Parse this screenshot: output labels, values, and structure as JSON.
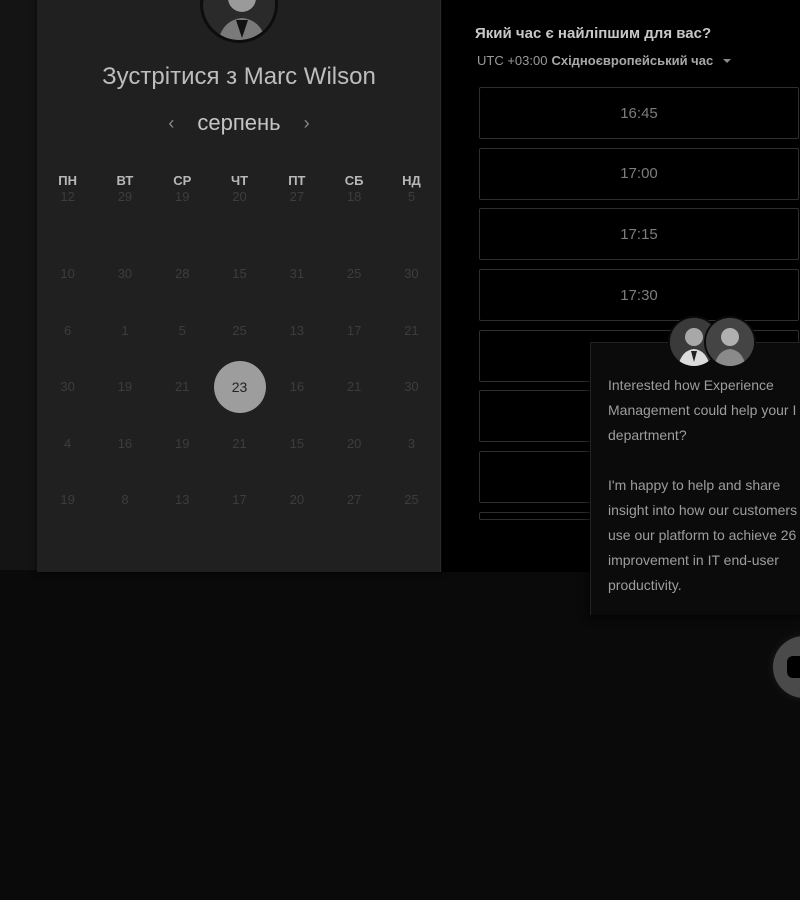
{
  "calendar": {
    "title": "Зустрітися з Marc Wilson",
    "month": "серпень",
    "prev_icon": "chevron-left-icon",
    "next_icon": "chevron-right-icon",
    "weekdays": [
      "ПН",
      "ВТ",
      "СР",
      "ЧТ",
      "ПТ",
      "СБ",
      "НД"
    ],
    "weeks": [
      [
        "12",
        "29",
        "19",
        "20",
        "27",
        "18",
        "5"
      ],
      [
        "10",
        "30",
        "28",
        "15",
        "31",
        "25",
        "30"
      ],
      [
        "6",
        "1",
        "5",
        "25",
        "13",
        "17",
        "21"
      ],
      [
        "30",
        "19",
        "21",
        "23",
        "16",
        "21",
        "30"
      ],
      [
        "4",
        "16",
        "19",
        "21",
        "15",
        "20",
        "3"
      ],
      [
        "19",
        "8",
        "13",
        "17",
        "20",
        "27",
        "25"
      ]
    ],
    "selected_day": "23"
  },
  "times": {
    "question": "Який час є найліпшим для вас?",
    "timezone_offset": "UTC +03:00",
    "timezone_name": "Східноєвропейський час",
    "slots": [
      "16:45",
      "17:00",
      "17:15",
      "17:30",
      "",
      "",
      "",
      ""
    ]
  },
  "chat": {
    "message": "Interested how Experience Management could help your I department?\n\nI'm happy to help and share insight into how our customers use our platform to achieve 26 improvement in IT end-user productivity.",
    "launcher_icon": "chat-bubble-icon"
  },
  "colors": {
    "card_bg": "#202020",
    "selected_day_bg": "#9d9d9d",
    "slot_border": "#2f2f2f"
  }
}
